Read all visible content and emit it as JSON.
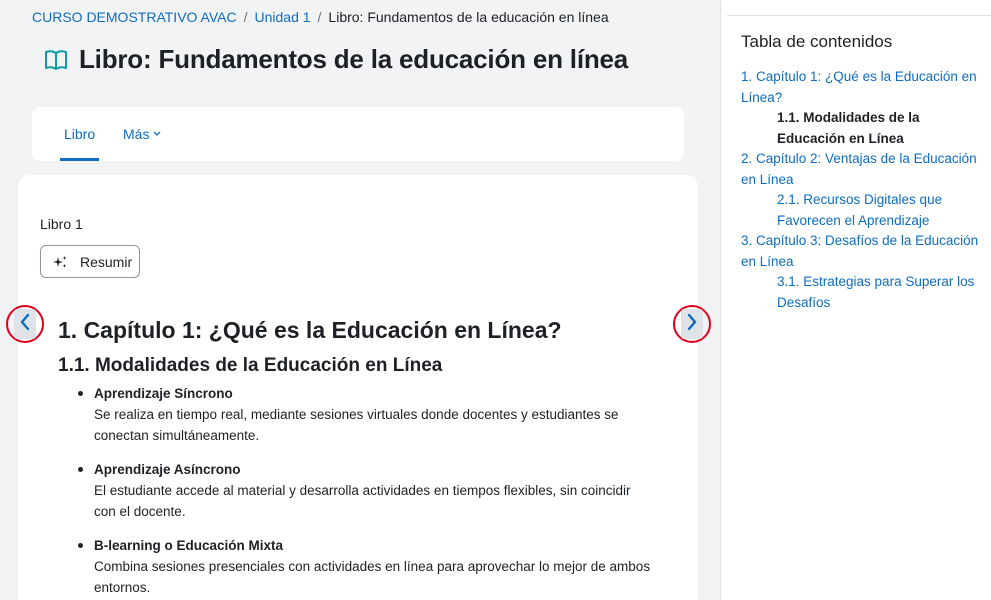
{
  "breadcrumb": {
    "items": [
      "CURSO DEMOSTRATIVO AVAC",
      "Unidad 1",
      "Libro: Fundamentos de la educación en línea"
    ],
    "separator": "/"
  },
  "page": {
    "icon": "book-icon",
    "title": "Libro: Fundamentos de la educación en línea"
  },
  "tabs": {
    "items": [
      {
        "label": "Libro",
        "active": true
      },
      {
        "label": "Más",
        "icon": "chevron-down-icon"
      }
    ]
  },
  "content": {
    "book_label": "Libro 1",
    "summarize_button": {
      "label": "Resumir",
      "icon": "sparkle-icon"
    },
    "prev_icon": "chevron-left-icon",
    "next_icon": "chevron-right-icon",
    "chapter_heading": "1. Capítulo 1: ¿Qué es la Educación en Línea?",
    "section_heading": "1.1. Modalidades de la Educación en Línea",
    "bullets": [
      {
        "title": "Aprendizaje Síncrono",
        "text": "Se realiza en tiempo real, mediante sesiones virtuales donde docentes y estudiantes se conectan simultáneamente."
      },
      {
        "title": "Aprendizaje Asíncrono",
        "text": "El estudiante accede al material y desarrolla actividades en tiempos flexibles, sin coincidir con el docente."
      },
      {
        "title": "B-learning o Educación Mixta",
        "text": "Combina sesiones presenciales con actividades en línea para aprovechar lo mejor de ambos entornos."
      }
    ]
  },
  "toc": {
    "title": "Tabla de contenidos",
    "items": [
      {
        "label": "1. Capítulo 1: ¿Qué es la Educación en Línea?",
        "level": 1
      },
      {
        "label": "1.1. Modalidades de la Educación en Línea",
        "level": 2,
        "current": true
      },
      {
        "label": "2. Capítulo 2: Ventajas de la Educación en Línea",
        "level": 1
      },
      {
        "label": "2.1. Recursos Digitales que Favorecen el Aprendizaje",
        "level": 2
      },
      {
        "label": "3. Capítulo 3: Desafíos de la Educación en Línea",
        "level": 1
      },
      {
        "label": "3.1. Estrategias para Superar los Desafíos",
        "level": 2
      }
    ]
  },
  "colors": {
    "link": "#0f6cbf",
    "text": "#1d2125",
    "page_bg": "#f2f3f5",
    "icon_teal": "#0d9ba5",
    "highlight_circle": "#e0001b"
  }
}
